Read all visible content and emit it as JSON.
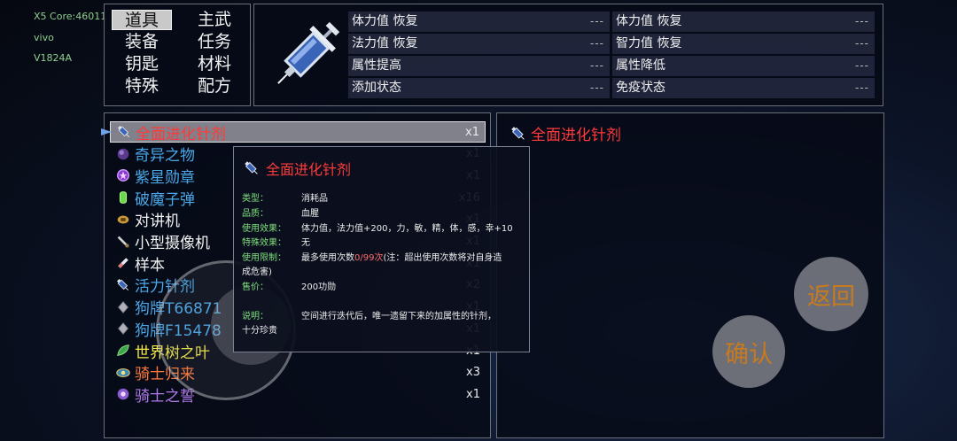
{
  "device_info": [
    "X5 Core:46011",
    "vivo",
    "V1824A"
  ],
  "categories": [
    {
      "label": "道具",
      "active": true
    },
    {
      "label": "主武",
      "active": false
    },
    {
      "label": "装备",
      "active": false
    },
    {
      "label": "任务",
      "active": false
    },
    {
      "label": "钥匙",
      "active": false
    },
    {
      "label": "材料",
      "active": false
    },
    {
      "label": "特殊",
      "active": false
    },
    {
      "label": "配方",
      "active": false
    }
  ],
  "stats": [
    {
      "label": "体力值  恢复",
      "value": "---"
    },
    {
      "label": "体力值  恢复",
      "value": "---"
    },
    {
      "label": "法力值  恢复",
      "value": "---"
    },
    {
      "label": "智力值  恢复",
      "value": "---"
    },
    {
      "label": "属性提高",
      "value": "---"
    },
    {
      "label": "属性降低",
      "value": "---"
    },
    {
      "label": "添加状态",
      "value": "---"
    },
    {
      "label": "免疫状态",
      "value": "---"
    }
  ],
  "items": [
    {
      "name": "全面进化针剂",
      "qty": "x1",
      "color": "#ff3a3a",
      "icon": "syringe-icon",
      "selected": true
    },
    {
      "name": "奇异之物",
      "qty": "x1",
      "color": "#4aa8e8",
      "icon": "orb-icon"
    },
    {
      "name": "紫星勋章",
      "qty": "x1",
      "color": "#4aa8e8",
      "icon": "medal-icon"
    },
    {
      "name": "破魔子弹",
      "qty": "x16",
      "color": "#4aa8e8",
      "icon": "bullet-icon"
    },
    {
      "name": "对讲机",
      "qty": "x1",
      "color": "#f2f2f2",
      "icon": "walkie-talkie-icon"
    },
    {
      "name": "小型摄像机",
      "qty": "x1",
      "color": "#f2f2f2",
      "icon": "camera-icon"
    },
    {
      "name": "样本",
      "qty": "x1",
      "color": "#f2f2f2",
      "icon": "sample-tube-icon"
    },
    {
      "name": "活力针剂",
      "qty": "x2",
      "color": "#4aa8e8",
      "icon": "syringe-icon"
    },
    {
      "name": "狗牌T66871",
      "qty": "x1",
      "color": "#4aa8e8",
      "icon": "dog-tag-icon"
    },
    {
      "name": "狗牌F15478",
      "qty": "x1",
      "color": "#4aa8e8",
      "icon": "dog-tag-icon"
    },
    {
      "name": "世界树之叶",
      "qty": "x1",
      "color": "#f2e84a",
      "icon": "leaf-icon"
    },
    {
      "name": "骑士归来",
      "qty": "x3",
      "color": "#ff7a3a",
      "icon": "eye-icon"
    },
    {
      "name": "骑士之誓",
      "qty": "x1",
      "color": "#b07ae8",
      "icon": "oath-orb-icon"
    }
  ],
  "detail": {
    "title": "全面进化针剂"
  },
  "tooltip": {
    "title": "全面进化针剂",
    "type_label": "类型：",
    "type_value": "消耗品",
    "quality_label": "品质：",
    "quality_value": "血腥",
    "effect_label": "使用效果：",
    "effect_value": "体力值，法力值+200，力，敏，精，体，感，幸+10",
    "special_label": "特殊效果：",
    "special_value": "无",
    "limit_label": "使用限制：",
    "limit_pre": "最多使用次数",
    "limit_count": "0/99次",
    "limit_post": "(注：超出使用次数将对自身造",
    "limit_cont": "成危害)",
    "price_label": "售价：",
    "price_value": "200功勋",
    "desc_label": "说明：",
    "desc_value": "空间进行迭代后，唯一遗留下来的加属性的针剂，",
    "desc_cont": "十分珍贵"
  },
  "buttons": {
    "back": "返回",
    "confirm": "确认"
  },
  "colors": {
    "rare_red": "#ff3a3a",
    "common_blue": "#4aa8e8",
    "label_green": "#7fe07f",
    "button_text": "#c87a1e"
  }
}
